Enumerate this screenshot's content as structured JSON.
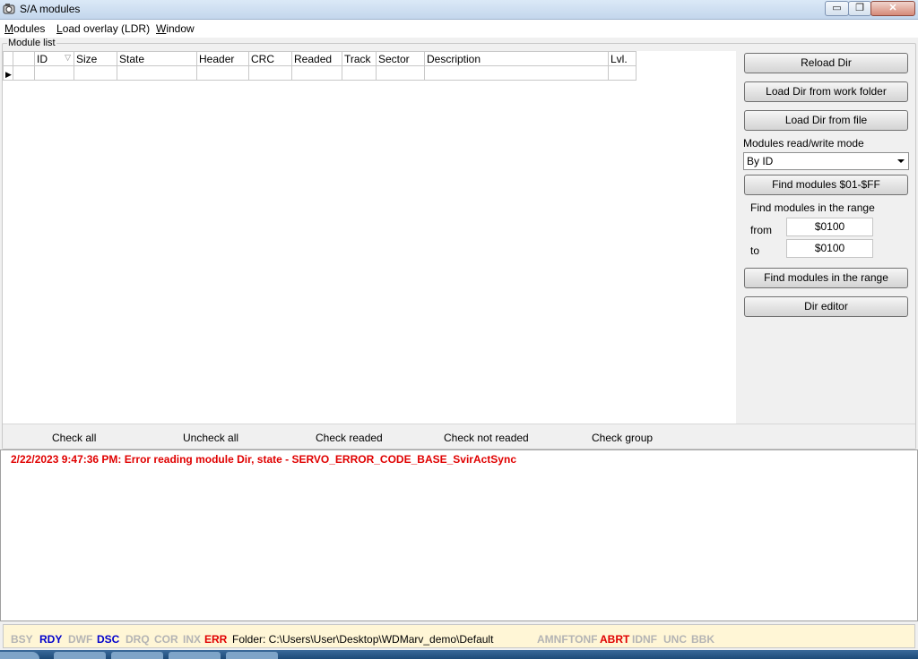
{
  "window": {
    "title": "S/A modules",
    "minimize_label": "▭",
    "restore_label": "❐",
    "close_label": "✕"
  },
  "menu": [
    {
      "mnemonic": "M",
      "rest": "odules"
    },
    {
      "mnemonic": "L",
      "rest": "oad overlay (LDR)"
    },
    {
      "mnemonic": "W",
      "rest": "indow"
    }
  ],
  "module_list": {
    "group_label": "Module list",
    "columns": [
      "ID",
      "Size",
      "State",
      "Header",
      "CRC",
      "Readed",
      "Track",
      "Sector",
      "Description",
      "Lvl."
    ],
    "current_row_marker": "▶"
  },
  "panel": {
    "reload_dir": "Reload Dir",
    "load_dir_work": "Load Dir from work folder",
    "load_dir_file": "Load Dir from file",
    "rw_mode_label": "Modules read/write mode",
    "rw_mode_value": "By ID",
    "find_all": "Find modules $01-$FF",
    "range_label": "Find modules in the range",
    "from_label": "from",
    "from_value": "$0100",
    "to_label": "to",
    "to_value": "$0100",
    "find_range": "Find modules in the range",
    "dir_editor": "Dir editor"
  },
  "links": {
    "check_all": "Check all",
    "uncheck_all": "Uncheck all",
    "check_readed": "Check readed",
    "check_not_readed": "Check not readed",
    "check_group": "Check group"
  },
  "log": {
    "line1": "2/22/2023 9:47:36 PM: Error reading module Dir, state - SERVO_ERROR_CODE_BASE_SvirActSync"
  },
  "status": {
    "bsy": "BSY",
    "rdy": "RDY",
    "dwf": "DWF",
    "dsc": "DSC",
    "drq": "DRQ",
    "cor": "COR",
    "inx": "INX",
    "err": "ERR",
    "folder": "Folder: C:\\Users\\User\\Desktop\\WDMarv_demo\\Default",
    "amnf": "AMNF",
    "tonf": "TONF",
    "abrt": "ABRT",
    "idnf": "IDNF",
    "unc": "UNC",
    "bbk": "BBK",
    "colors": {
      "active_blue": "#0000cc",
      "active_red": "#e00000",
      "inactive": "#b4b4b4"
    }
  }
}
